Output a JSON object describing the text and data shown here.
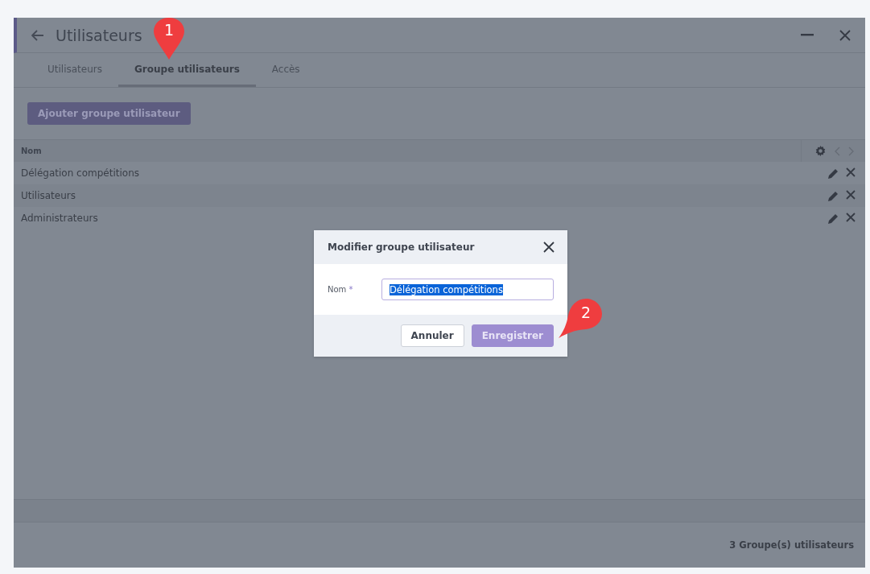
{
  "window": {
    "title": "Utilisateurs"
  },
  "tabs": [
    {
      "label": "Utilisateurs",
      "selected": false
    },
    {
      "label": "Groupe utilisateurs",
      "selected": true
    },
    {
      "label": "Accès",
      "selected": false
    }
  ],
  "add_button": "Ajouter groupe utilisateur",
  "table": {
    "columns": [
      "Nom"
    ],
    "rows": [
      {
        "name": "Délégation compétitions"
      },
      {
        "name": "Utilisateurs"
      },
      {
        "name": "Administrateurs"
      }
    ]
  },
  "status_bar": "3 Groupe(s) utilisateurs",
  "dialog": {
    "title": "Modifier groupe utilisateur",
    "field_label": "Nom",
    "required_mark": "*",
    "value": "Délégation compétitions",
    "value_selected": true,
    "buttons": [
      {
        "label": "Annuler",
        "kind": "secondary"
      },
      {
        "label": "Enregistrer",
        "kind": "primary"
      }
    ]
  },
  "callouts": [
    "1",
    "2"
  ]
}
